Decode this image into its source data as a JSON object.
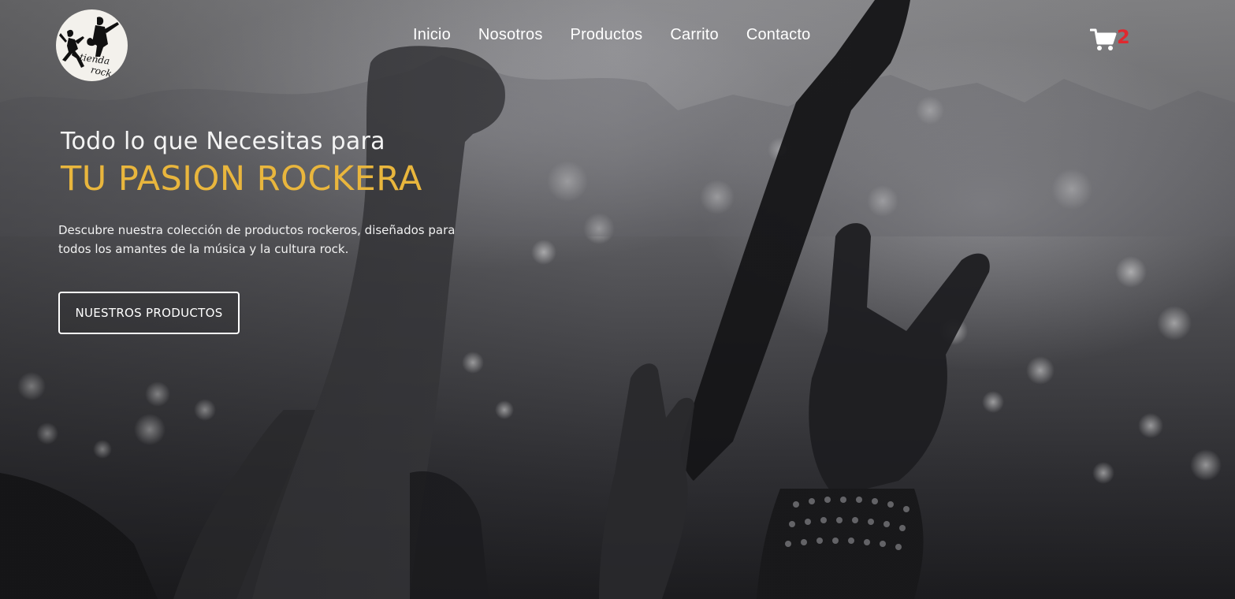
{
  "brand": {
    "logo_line1": "tienda",
    "logo_line2": "rock"
  },
  "nav": {
    "items": [
      {
        "label": "Inicio"
      },
      {
        "label": "Nosotros"
      },
      {
        "label": "Productos"
      },
      {
        "label": "Carrito"
      },
      {
        "label": "Contacto"
      }
    ]
  },
  "cart": {
    "icon": "shopping-cart-icon",
    "count": "2",
    "count_color": "#e0282e"
  },
  "hero": {
    "subtitle": "Todo lo que Necesitas para",
    "title": "TU PASION ROCKERA",
    "title_color": "#e9b63d",
    "description": "Descubre nuestra colección de productos rockeros, diseñados para todos los amantes de la música y la cultura rock.",
    "cta_label": "NUESTROS PRODUCTOS"
  }
}
